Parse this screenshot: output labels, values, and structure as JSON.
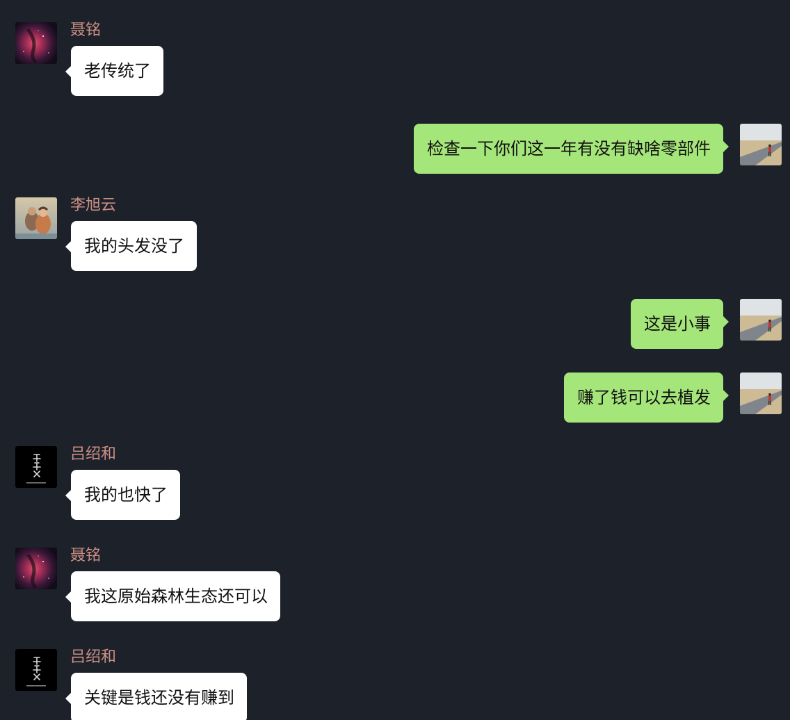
{
  "theme": {
    "background": "#1c212a",
    "incoming_bubble": "#ffffff",
    "outgoing_bubble": "#a5e67a",
    "sender_name_color": "#cc8f86",
    "text_color": "#111111"
  },
  "messages": [
    {
      "direction": "incoming",
      "sender": "聂铭",
      "avatar_icon": "galaxy-nebula-avatar",
      "text": "老传统了"
    },
    {
      "direction": "outgoing",
      "avatar_icon": "desert-road-avatar",
      "text": "检查一下你们这一年有没有缺啥零部件"
    },
    {
      "direction": "incoming",
      "sender": "李旭云",
      "avatar_icon": "couple-photo-avatar",
      "text": "我的头发没了"
    },
    {
      "direction": "outgoing",
      "avatar_icon": "desert-road-avatar",
      "text": "这是小事"
    },
    {
      "direction": "outgoing",
      "avatar_icon": "desert-road-avatar",
      "text": "赚了钱可以去植发"
    },
    {
      "direction": "incoming",
      "sender": "吕绍和",
      "avatar_icon": "calligraphy-logo-avatar",
      "text": "我的也快了"
    },
    {
      "direction": "incoming",
      "sender": "聂铭",
      "avatar_icon": "galaxy-nebula-avatar",
      "text": "我这原始森林生态还可以"
    },
    {
      "direction": "incoming",
      "sender": "吕绍和",
      "avatar_icon": "calligraphy-logo-avatar",
      "text": "关键是钱还没有赚到"
    }
  ]
}
